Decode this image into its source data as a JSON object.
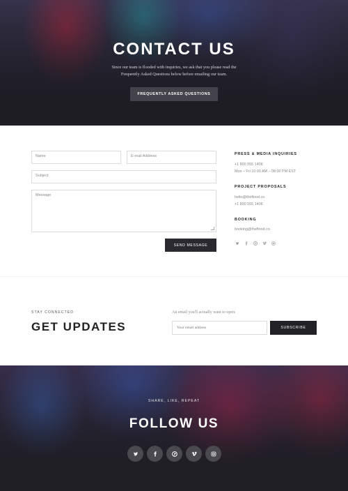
{
  "hero": {
    "title": "CONTACT US",
    "subtitle": "Since our team is flooded with inquiries, we ask that you please read the Frequently Asked Questions below before emailing our team.",
    "button_label": "FREQUENTLY ASKED QUESTIONS"
  },
  "contact_form": {
    "name_placeholder": "Name",
    "email_placeholder": "E-mail Address",
    "subject_placeholder": "Subject",
    "message_placeholder": "Message",
    "send_label": "SEND MESSAGE"
  },
  "contact_info": {
    "press": {
      "heading": "PRESS & MEDIA INQUIRIES",
      "phone": "+1 800 555 1406",
      "hours": "Mon – Fri 10:00 AM – 08:00 PM EST"
    },
    "proposals": {
      "heading": "PROJECT PROPOSALS",
      "email": "hello@theflood.co",
      "phone": "+1 800 555 1406"
    },
    "booking": {
      "heading": "BOOKING",
      "email": "booking@theflood.co"
    },
    "social_icons": [
      "twitter-icon",
      "facebook-icon",
      "pinterest-icon",
      "vimeo-icon",
      "instagram-icon"
    ]
  },
  "updates": {
    "eyebrow": "STAY CONNECTED",
    "title": "GET UPDATES",
    "note": "An email you'll actually want to open:",
    "email_placeholder": "Your email address",
    "subscribe_label": "SUBSCRIBE"
  },
  "follow": {
    "eyebrow": "SHARE, LIKE, REPEAT",
    "title": "FOLLOW US",
    "social_icons": [
      "twitter-icon",
      "facebook-icon",
      "pinterest-icon",
      "vimeo-icon",
      "instagram-icon"
    ]
  },
  "colors": {
    "dark_button": "#2a292f",
    "hero_button": "#44434b",
    "social_circle": "#4a4950",
    "border": "#dcdce0"
  }
}
